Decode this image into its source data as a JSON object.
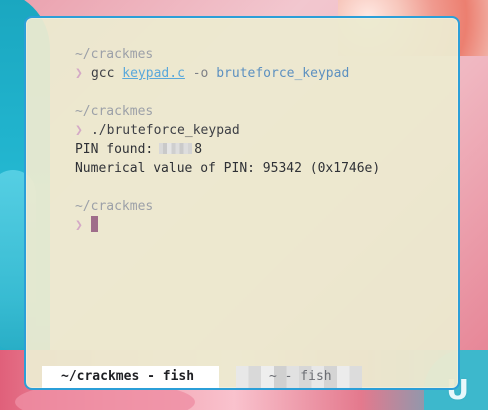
{
  "colors": {
    "terminal_border": "#2b9fd8",
    "terminal_background": "#ecead0",
    "prompt_path": "#9ca0a8",
    "prompt_symbol": "#d4a9c6",
    "link": "#59a8db",
    "cursor": "#9f6d8a"
  },
  "terminal": {
    "lines": {
      "prompt_1_path": "~/crackmes",
      "prompt_1_symbol": "❯",
      "command_1_program": "gcc",
      "command_1_file": "keypad.c",
      "command_1_flag": "-o",
      "command_1_output": "bruteforce_keypad",
      "prompt_2_path": "~/crackmes",
      "prompt_2_symbol": "❯",
      "command_2": "./bruteforce_keypad",
      "pin_found_label": "PIN found:",
      "pin_found_visible_suffix": "8",
      "numeric_value_line": "Numerical value of PIN: 95342 (0x1746e)",
      "prompt_3_path": "~/crackmes",
      "prompt_3_symbol": "❯"
    },
    "tabs": [
      {
        "label": "~/crackmes - fish",
        "active": true
      },
      {
        "label": "~ - fish",
        "active": false
      }
    ]
  },
  "wallpaper": {
    "corner_text": "U"
  },
  "icons": {
    "prompt": "chevron-right-icon",
    "cursor": "text-cursor-icon"
  }
}
